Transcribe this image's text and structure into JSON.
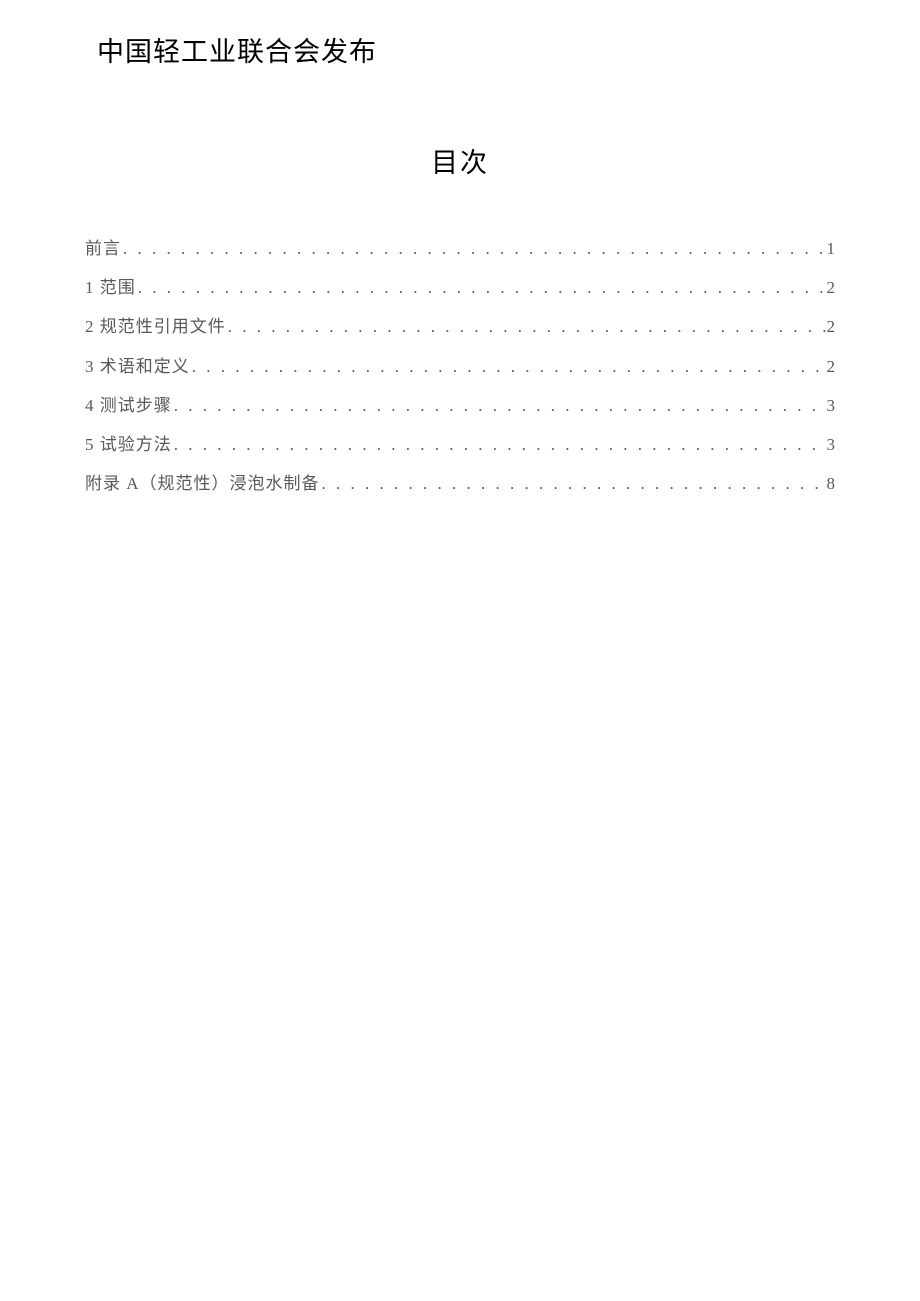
{
  "publisher": "中国轻工业联合会发布",
  "toc_title": "目次",
  "toc_items": [
    {
      "label": "前言",
      "page": "1"
    },
    {
      "label": "1 范围",
      "page": "2"
    },
    {
      "label": "2 规范性引用文件",
      "page": "2"
    },
    {
      "label": "3 术语和定义",
      "page": "2"
    },
    {
      "label": "4 测试步骤",
      "page": "3"
    },
    {
      "label": "5 试验方法",
      "page": "3"
    },
    {
      "label": "附录 A（规范性）浸泡水制备",
      "page": "8"
    }
  ]
}
